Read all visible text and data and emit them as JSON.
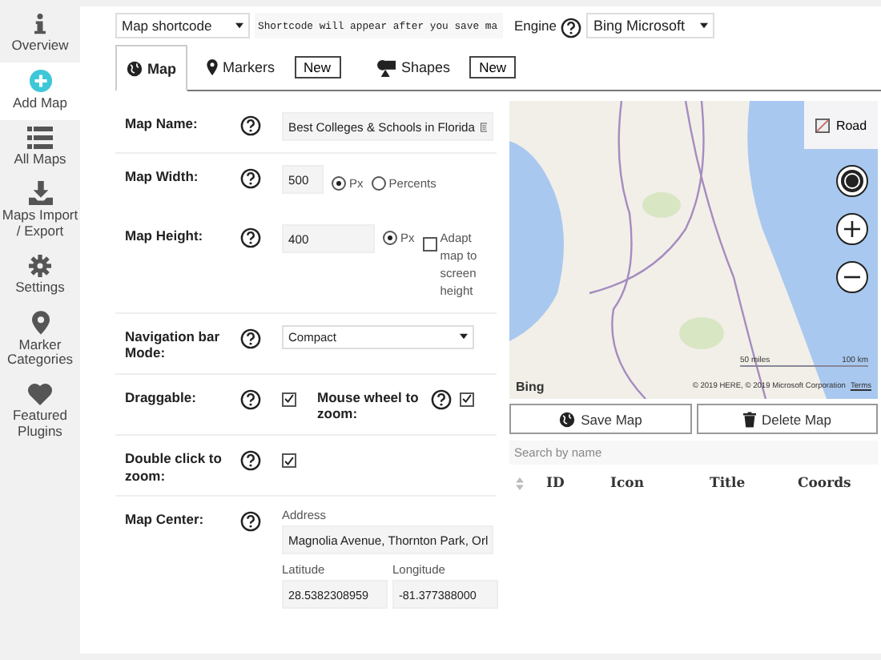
{
  "sidebar": {
    "items": [
      {
        "label": "Overview",
        "selected": false
      },
      {
        "label": "Add Map",
        "selected": true
      },
      {
        "label": "All Maps",
        "selected": false
      },
      {
        "label": "Maps Import / Export",
        "selected": false
      },
      {
        "label": "Settings",
        "selected": false
      },
      {
        "label": "Marker Categories",
        "selected": false
      },
      {
        "label": "Featured Plugins",
        "selected": false
      }
    ]
  },
  "toolbar": {
    "shortcode_select": {
      "value": "Map shortcode"
    },
    "shortcode_field": {
      "value": "Shortcode will appear after you save ma"
    },
    "engine": {
      "label": "Engine",
      "value": "Bing Microsoft"
    }
  },
  "tabs": [
    {
      "label": "Map",
      "selected": true
    },
    {
      "label": "Markers",
      "selected": false,
      "new_button": "New"
    },
    {
      "label": "Shapes",
      "selected": false,
      "new_button": "New"
    }
  ],
  "form": {
    "rows": [
      {
        "kind": "text",
        "label": "Map Name:",
        "value": "Best Colleges & Schools in Florida"
      },
      {
        "kind": "size",
        "label": "Map Width:",
        "value": "500",
        "options": [
          {
            "label": "Px",
            "selected": true
          },
          {
            "label": "Percents",
            "selected": false
          }
        ]
      },
      {
        "kind": "height",
        "label": "Map Height:",
        "value": "400",
        "options": [
          {
            "label": "Px",
            "selected": true
          }
        ],
        "check": {
          "label": "Adapt map to screen height",
          "checked": false
        }
      },
      {
        "kind": "select",
        "label": "Navigation bar Mode:",
        "value": "Compact"
      },
      {
        "kind": "pair",
        "label": "Draggable:",
        "checked": true,
        "second": {
          "label": "Mouse wheel to zoom:",
          "checked": true
        }
      },
      {
        "kind": "check",
        "label": "Double click to zoom:",
        "checked": true
      },
      {
        "kind": "center",
        "label": "Map Center:",
        "address_label": "Address",
        "address": "Magnolia Avenue, Thornton Park, Orl",
        "latitude_label": "Latitude",
        "latitude": "28.5382308959",
        "longitude_label": "Longitude",
        "longitude": "-81.377388000"
      }
    ]
  },
  "map": {
    "type_button": "Road",
    "logo": "Bing",
    "scale_miles": "50 miles",
    "scale_km": "100 km",
    "attribution": "© 2019 HERE, © 2019 Microsoft Corporation",
    "terms_link": "Terms"
  },
  "actions": [
    {
      "label": "Save Map",
      "kind": "save"
    },
    {
      "label": "Delete Map",
      "kind": "delete"
    }
  ],
  "markers": {
    "search": {
      "placeholder": "Search by name"
    },
    "columns": [
      "ID",
      "Icon",
      "Title",
      "Coords"
    ]
  }
}
